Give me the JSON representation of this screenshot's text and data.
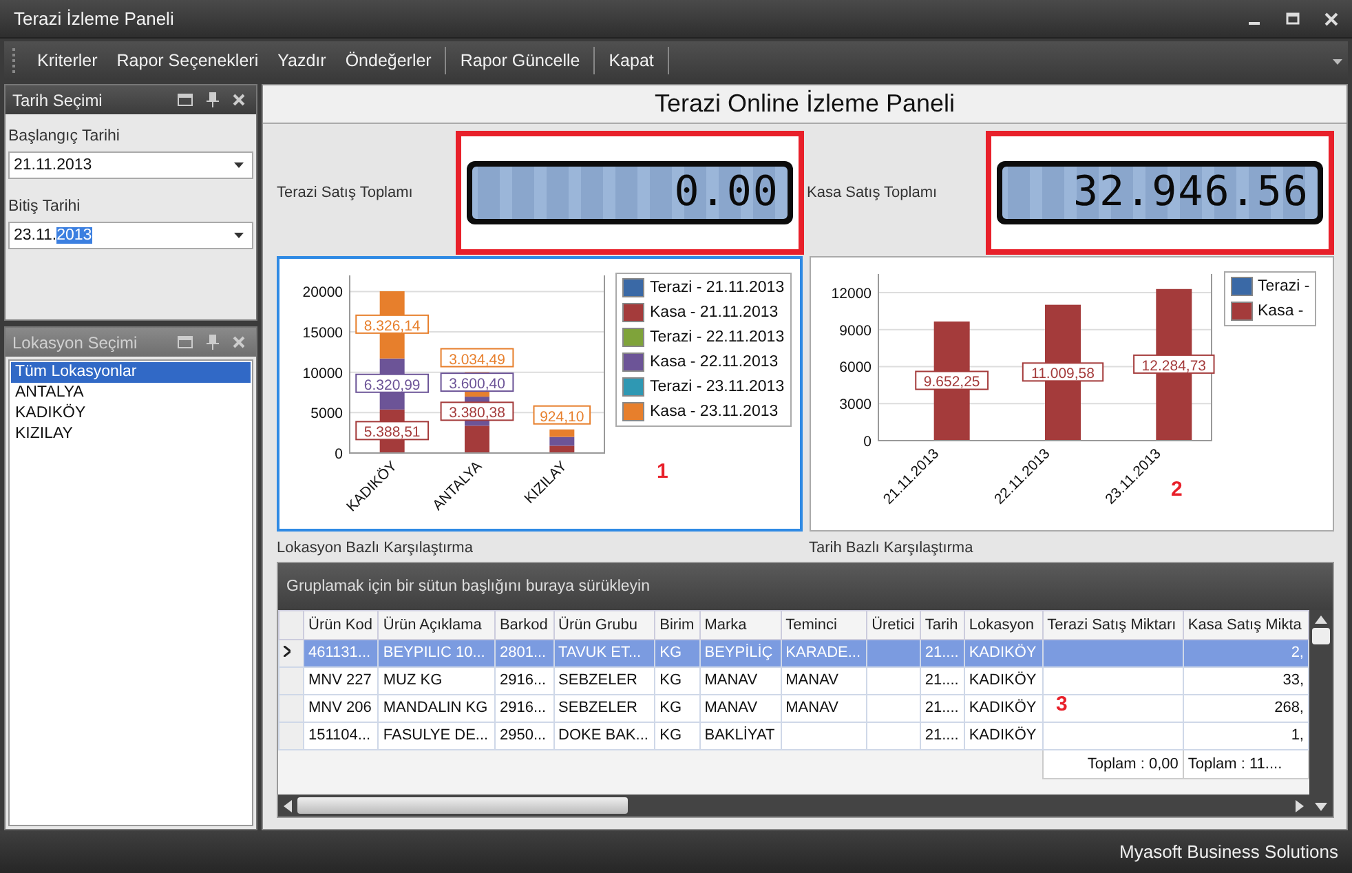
{
  "window": {
    "title": "Terazi İzleme Paneli"
  },
  "toolbar": [
    {
      "kind": "button",
      "label": "Kriterler"
    },
    {
      "kind": "button",
      "label": "Rapor Seçenekleri"
    },
    {
      "kind": "button",
      "label": "Yazdır"
    },
    {
      "kind": "button",
      "label": "Öndeğerler"
    },
    {
      "kind": "separator"
    },
    {
      "kind": "button",
      "label": "Rapor Güncelle"
    },
    {
      "kind": "separator"
    },
    {
      "kind": "button",
      "label": "Kapat"
    },
    {
      "kind": "separator"
    }
  ],
  "date_panel": {
    "title": "Tarih Seçimi",
    "active": true,
    "fields": [
      {
        "label": "Başlangıç Tarihi",
        "value": "21.11.2013"
      },
      {
        "label": "Bitiş Tarihi",
        "value": "23.11.",
        "selection": "2013"
      }
    ]
  },
  "location_panel": {
    "title": "Lokasyon Seçimi",
    "active": false,
    "items": [
      {
        "label": "Tüm Lokasyonlar",
        "selected": true
      },
      {
        "label": "ANTALYA",
        "selected": false
      },
      {
        "label": "KADIKÖY",
        "selected": false
      },
      {
        "label": "KIZILAY",
        "selected": false
      }
    ]
  },
  "main": {
    "title": "Terazi Online İzleme Paneli",
    "totals": [
      {
        "label": "Terazi Satış Toplamı",
        "display": "0.00",
        "highlighted": true
      },
      {
        "label": "Kasa Satış Toplamı",
        "display": "32.946.56",
        "highlighted": true
      }
    ],
    "charts": [
      {
        "caption": "Lokasyon Bazlı Karşılaştırma",
        "focused": true,
        "annotation": "1",
        "legend_shown": true,
        "chart_data": {
          "type": "bar",
          "stacked": true,
          "grid": true,
          "categories": [
            "KADIKÖY",
            "ANTALYA",
            "KIZILAY"
          ],
          "ylim": [
            0,
            22000
          ],
          "yticks": [
            0,
            5000,
            10000,
            15000,
            20000
          ],
          "series": [
            {
              "name": "Terazi - 21.11.2013",
              "color": "#3a69a6",
              "values": [
                0,
                0,
                0
              ],
              "value_labels": [
                null,
                null,
                null
              ]
            },
            {
              "name": "Kasa - 21.11.2013",
              "color": "#a43b3b",
              "values": [
                5388.51,
                3380.38,
                900
              ],
              "value_labels": [
                "5.388,51",
                "3.380,38",
                null
              ]
            },
            {
              "name": "Terazi - 22.11.2013",
              "color": "#7fa33a",
              "values": [
                0,
                0,
                0
              ],
              "value_labels": [
                null,
                null,
                null
              ]
            },
            {
              "name": "Kasa - 22.11.2013",
              "color": "#6c5497",
              "values": [
                6320.99,
                3600.4,
                1100
              ],
              "value_labels": [
                "6.320,99",
                "3.600,40",
                null
              ]
            },
            {
              "name": "Terazi - 23.11.2013",
              "color": "#2f98b3",
              "values": [
                0,
                0,
                0
              ],
              "value_labels": [
                null,
                null,
                null
              ]
            },
            {
              "name": "Kasa - 23.11.2013",
              "color": "#e77f2c",
              "values": [
                8326.14,
                3034.49,
                924.1
              ],
              "value_labels": [
                "8.326,14",
                "3.034,49",
                "924,10"
              ]
            }
          ]
        }
      },
      {
        "caption": "Tarih Bazlı Karşılaştırma",
        "focused": false,
        "annotation": "2",
        "legend_shown": true,
        "chart_data": {
          "type": "bar",
          "stacked": false,
          "grid": true,
          "categories": [
            "21.11.2013",
            "22.11.2013",
            "23.11.2013"
          ],
          "ylim": [
            0,
            13500
          ],
          "yticks": [
            0,
            3000,
            6000,
            9000,
            12000
          ],
          "series": [
            {
              "name": "Terazi -",
              "color": "#3a69a6",
              "values": [
                0,
                0,
                0
              ],
              "value_labels": [
                null,
                null,
                null
              ]
            },
            {
              "name": "Kasa -",
              "color": "#a43b3b",
              "values": [
                9652.25,
                11009.58,
                12284.73
              ],
              "value_labels": [
                "9.652,25",
                "11.009,58",
                "12.284,73"
              ]
            }
          ]
        }
      }
    ]
  },
  "table": {
    "group_hint": "Gruplamak için bir sütun başlığını buraya sürükleyin",
    "annotation": "3",
    "columns": [
      {
        "label": "Ürün Kod",
        "kind": "text"
      },
      {
        "label": "Ürün Açıklama",
        "kind": "text"
      },
      {
        "label": "Barkod",
        "kind": "text"
      },
      {
        "label": "Ürün Grubu",
        "kind": "text"
      },
      {
        "label": "Birim",
        "kind": "text"
      },
      {
        "label": "Marka",
        "kind": "text"
      },
      {
        "label": "Teminci",
        "kind": "text"
      },
      {
        "label": "Üretici",
        "kind": "text"
      },
      {
        "label": "Tarih",
        "kind": "text"
      },
      {
        "label": "Lokasyon",
        "kind": "text"
      },
      {
        "label": "Terazi Satış Miktarı",
        "kind": "number"
      },
      {
        "label": "Kasa Satış Mikta",
        "kind": "number"
      }
    ],
    "rows": [
      {
        "selected": true,
        "cells": [
          "461131...",
          "BEYPILIC 10...",
          "2801...",
          "TAVUK ET...",
          "KG",
          "BEYPİLİÇ",
          "KARADE...",
          "",
          "21....",
          "KADIKÖY",
          "",
          "2,"
        ]
      },
      {
        "selected": false,
        "cells": [
          "MNV 227",
          "MUZ  KG",
          "2916...",
          "SEBZELER",
          "KG",
          "MANAV",
          "MANAV",
          "",
          "21....",
          "KADIKÖY",
          "",
          "33,"
        ]
      },
      {
        "selected": false,
        "cells": [
          "MNV 206",
          "MANDALIN  KG",
          "2916...",
          "SEBZELER",
          "KG",
          "MANAV",
          "MANAV",
          "",
          "21....",
          "KADIKÖY",
          "",
          "268,"
        ]
      },
      {
        "selected": false,
        "cells": [
          "151104...",
          "FASULYE DE...",
          "2950...",
          "DOKE BAK...",
          "KG",
          "BAKLİYAT",
          "",
          "",
          "21....",
          "KADIKÖY",
          "",
          "1,"
        ]
      }
    ],
    "footer": [
      "Toplam : 0,00",
      "Toplam : 11...."
    ]
  },
  "status_bar": {
    "text": "Myasoft Business Solutions"
  }
}
